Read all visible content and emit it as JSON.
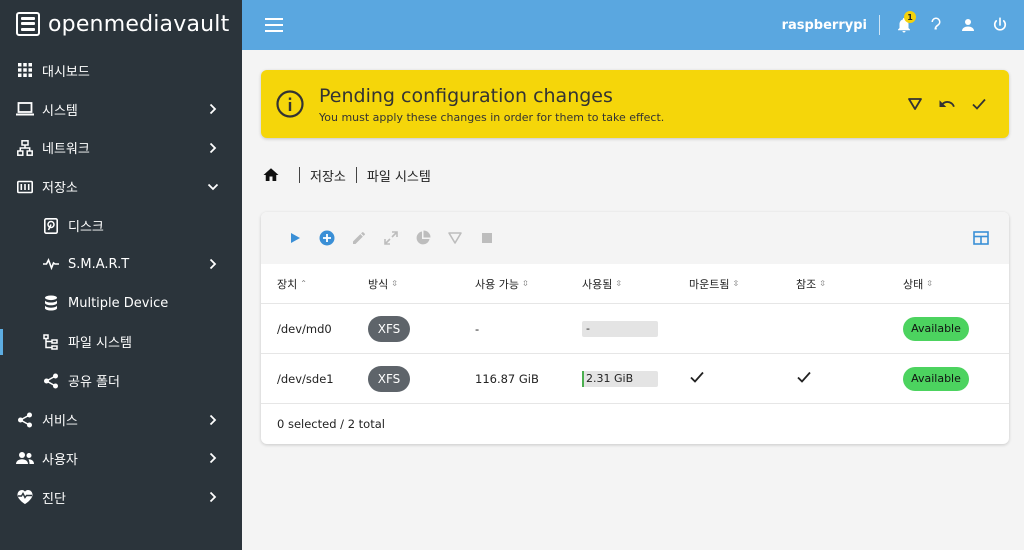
{
  "brand": {
    "name": "openmediavault"
  },
  "sidebar": {
    "items": [
      {
        "label": "대시보드",
        "icon": "dashboard-icon",
        "chevron": ""
      },
      {
        "label": "시스템",
        "icon": "laptop-icon",
        "chevron": "right"
      },
      {
        "label": "네트워크",
        "icon": "network-icon",
        "chevron": "right"
      },
      {
        "label": "저장소",
        "icon": "storage-icon",
        "chevron": "down"
      },
      {
        "label": "디스크",
        "icon": "disk-icon",
        "chevron": "",
        "sub": true
      },
      {
        "label": "S.M.A.R.T",
        "icon": "pulse-icon",
        "chevron": "right",
        "sub": true
      },
      {
        "label": "Multiple Device",
        "icon": "database-icon",
        "chevron": "",
        "sub": true
      },
      {
        "label": "파일 시스템",
        "icon": "file-tree-icon",
        "chevron": "",
        "sub": true,
        "active": true
      },
      {
        "label": "공유 폴더",
        "icon": "share-icon",
        "chevron": "",
        "sub": true
      },
      {
        "label": "서비스",
        "icon": "share-icon",
        "chevron": "right"
      },
      {
        "label": "사용자",
        "icon": "users-icon",
        "chevron": "right"
      },
      {
        "label": "진단",
        "icon": "heart-pulse-icon",
        "chevron": "right"
      }
    ]
  },
  "topbar": {
    "hostname": "raspberrypi",
    "notification_count": "1"
  },
  "alert": {
    "title": "Pending configuration changes",
    "message": "You must apply these changes in order for them to take effect."
  },
  "breadcrumb": {
    "items": [
      "저장소",
      "파일 시스템"
    ]
  },
  "table": {
    "columns": [
      "장치",
      "방식",
      "사용 가능",
      "사용됨",
      "마운트됨",
      "참조",
      "상태"
    ],
    "rows": [
      {
        "device": "/dev/md0",
        "type": "XFS",
        "available": "-",
        "used": "-",
        "used_fraction": 0,
        "mounted": false,
        "referenced": false,
        "status": "Available"
      },
      {
        "device": "/dev/sde1",
        "type": "XFS",
        "available": "116.87 GiB",
        "used": "2.31 GiB",
        "used_fraction": 0.02,
        "mounted": true,
        "referenced": true,
        "status": "Available"
      }
    ],
    "footer": "0 selected / 2 total"
  },
  "colors": {
    "sidebar_bg": "#2b343b",
    "topbar_bg": "#5aa7e0",
    "alert_bg": "#f5d60a",
    "status_available": "#4cd35f",
    "chip_bg": "#5e646a",
    "accent": "#3a8fd6"
  }
}
